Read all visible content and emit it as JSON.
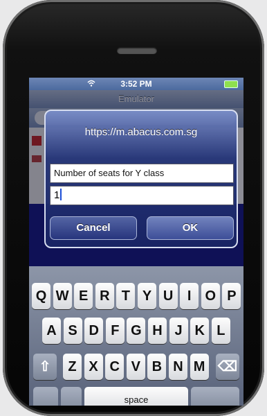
{
  "status": {
    "time": "3:52 PM",
    "carrier_icon": "wifi-icon",
    "battery_icon": "battery-icon"
  },
  "browser": {
    "title": "Emulator"
  },
  "dialog": {
    "title": "https://m.abacus.com.sg",
    "label": "Number of seats for Y class",
    "input_value": "1",
    "cancel_label": "Cancel",
    "ok_label": "OK"
  },
  "keyboard": {
    "row1": [
      "Q",
      "W",
      "E",
      "R",
      "T",
      "Y",
      "U",
      "I",
      "O",
      "P"
    ],
    "row2": [
      "A",
      "S",
      "D",
      "F",
      "G",
      "H",
      "J",
      "K",
      "L"
    ],
    "row3": [
      "Z",
      "X",
      "C",
      "V",
      "B",
      "N",
      "M"
    ],
    "shift_icon": "shift-arrow-icon",
    "delete_icon": "delete-backspace-icon",
    "space_label": "space"
  },
  "colors": {
    "dialog_bg": "#25357d",
    "page_band": "#1c1f8c",
    "keyboard_bg": "#6f7890"
  }
}
